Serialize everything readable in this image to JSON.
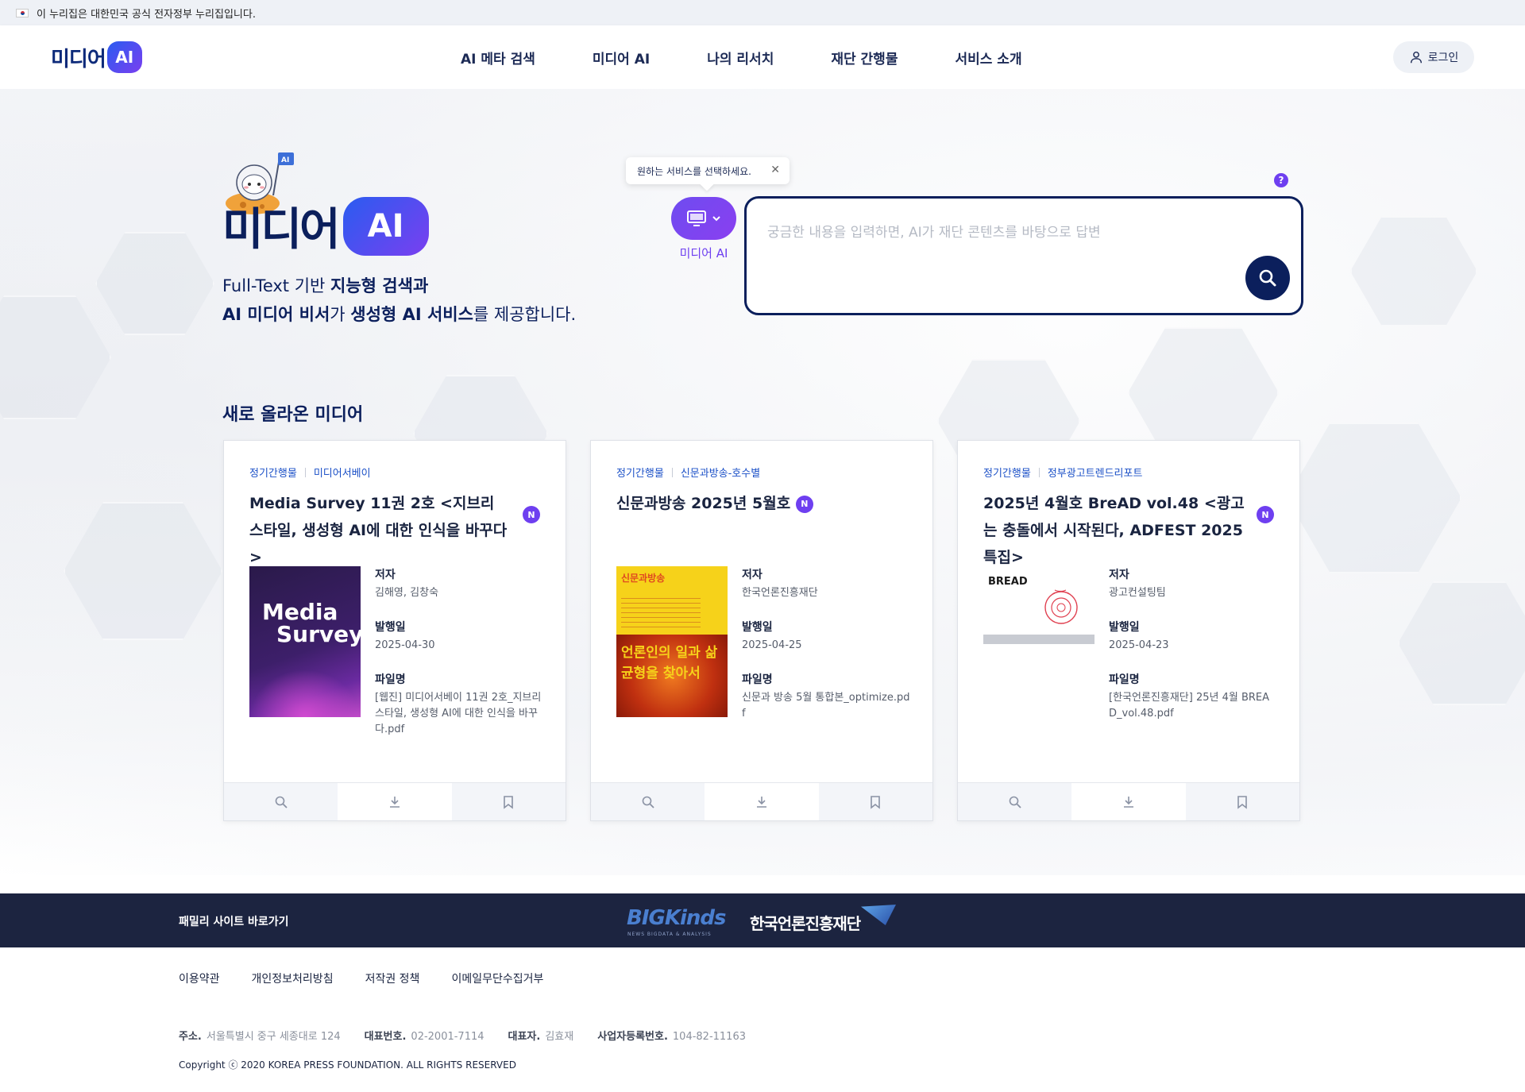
{
  "gov_banner": {
    "text": "이 누리집은 대한민국 공식 전자정부 누리집입니다."
  },
  "header": {
    "logo_text": "미디어",
    "logo_ai": "AI",
    "nav": [
      "AI 메타 검색",
      "미디어 AI",
      "나의 리서치",
      "재단 간행물",
      "서비스 소개"
    ],
    "login_label": "로그인"
  },
  "hero": {
    "logo_text": "미디어",
    "logo_ai": "AI",
    "tagline_line1_a": "Full-Text 기반 ",
    "tagline_line1_b": "지능형 검색과",
    "tagline_line2_a": "AI 미디어 비서",
    "tagline_line2_b": "가 ",
    "tagline_line2_c": "생성형 AI 서비스",
    "tagline_line2_d": "를 제공합니다.",
    "tooltip": "원하는 서비스를 선택하세요.",
    "service_label": "미디어 AI",
    "search_placeholder": "궁금한 내용을 입력하면, AI가 재단 콘텐츠를 바탕으로 답변",
    "help": "?"
  },
  "section_title": "새로 올라온 미디어",
  "meta_labels": {
    "author": "저자",
    "date": "발행일",
    "file": "파일명"
  },
  "cards": [
    {
      "tag1": "정기간행물",
      "tag2": "미디어서베이",
      "title": "Media Survey 11권 2호 <지브리 스타일, 생성형 AI에 대한 인식을 바꾸다>",
      "badge": "N",
      "author": "김해영, 김창숙",
      "date": "2025-04-30",
      "file": "[웹진] 미디어서베이 11권 2호_지브리 스타일, 생성형 AI에 대한 인식을 바꾸다.pdf"
    },
    {
      "tag1": "정기간행물",
      "tag2": "신문과방송-호수별",
      "title": "신문과방송 2025년 5월호",
      "badge": "N",
      "author": "한국언론진흥재단",
      "date": "2025-04-25",
      "file": "신문과 방송 5월 통합본_optimize.pdf"
    },
    {
      "tag1": "정기간행물",
      "tag2": "정부광고트렌드리포트",
      "title": "2025년 4월호 BreAD vol.48 <광고는 충돌에서 시작된다, ADFEST 2025 특집>",
      "badge": "N",
      "author": "광고컨설팅팀",
      "date": "2025-04-23",
      "file": "[한국언론진흥재단] 25년 4월 BREAD_vol.48.pdf"
    }
  ],
  "thumbs": {
    "ms_title_1": "Media",
    "ms_title_2": "Survey",
    "sb_title": "신문과방송",
    "sb_big_1": "언론인의 일과 삶",
    "sb_big_2": "균형을 찾아서",
    "bread": "BREAD"
  },
  "footer": {
    "family_label": "패밀리 사이트 바로가기",
    "bigkinds": "BIGKinds",
    "bigkinds_sub": "NEWS BIGDATA & ANALYSIS",
    "kpf": "한국언론진흥재단",
    "links": [
      "이용약관",
      "개인정보처리방침",
      "저작권 정책",
      "이메일무단수집거부"
    ],
    "address_label": "주소.",
    "address": "서울특별시 중구 세종대로 124",
    "phone_label": "대표번호.",
    "phone": "02-2001-7114",
    "ceo_label": "대표자.",
    "ceo": "김효재",
    "biz_label": "사업자등록번호.",
    "biz": "104-82-11163",
    "copyright": "Copyright ⓒ 2020 KOREA PRESS FOUNDATION. ALL RIGHTS RESERVED"
  },
  "colors": {
    "navy": "#0b1f5c",
    "purple": "#6e3ff0",
    "link_blue": "#1b50c7",
    "footer_bg": "#1c2440"
  }
}
